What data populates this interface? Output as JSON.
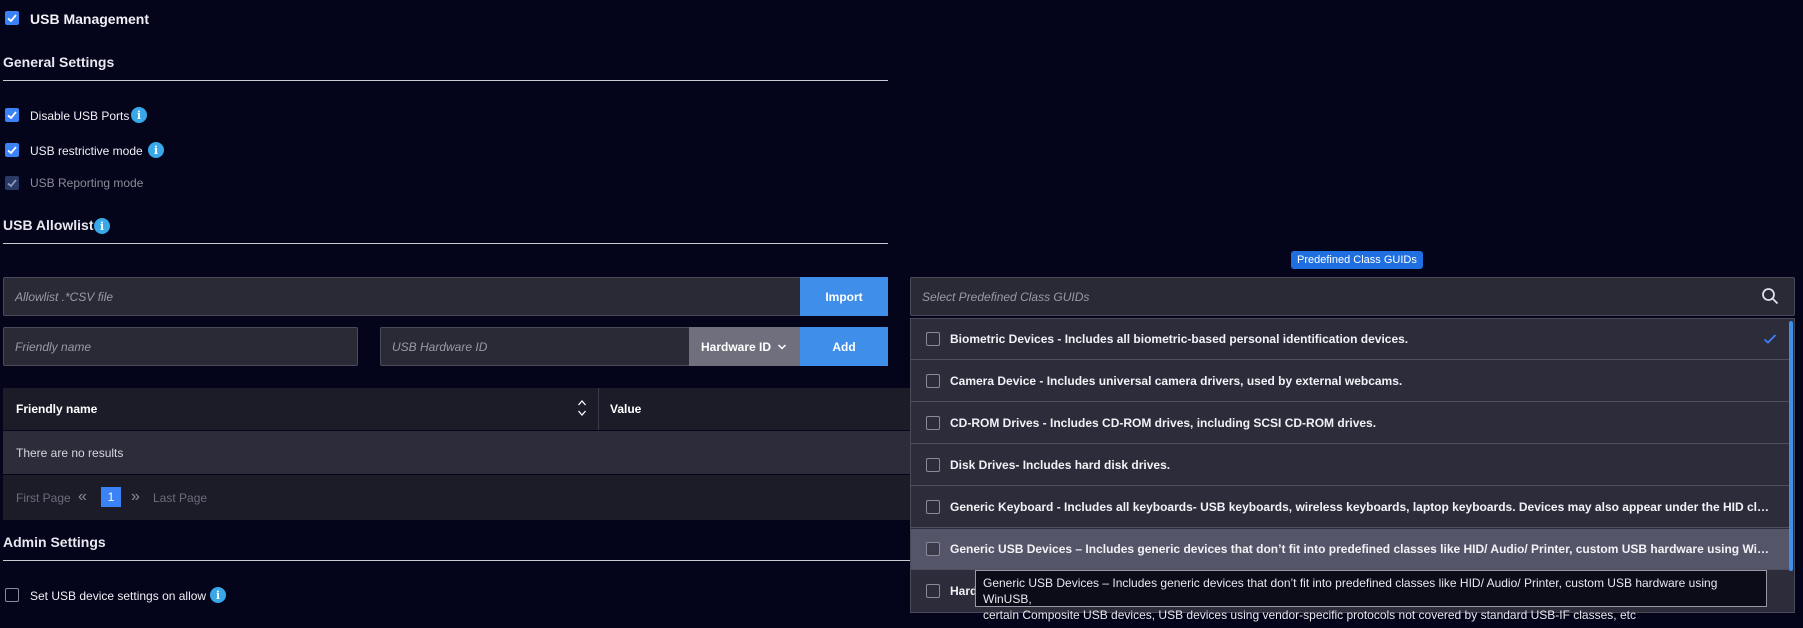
{
  "header": {
    "usb_management": {
      "label": "USB Management",
      "checked": true
    }
  },
  "general": {
    "title": "General Settings",
    "options": [
      {
        "label": "Disable USB Ports",
        "checked": true,
        "info": true
      },
      {
        "label": "USB restrictive mode",
        "checked": true,
        "info": true
      },
      {
        "label": "USB Reporting mode",
        "checked": true,
        "disabled": true,
        "info": false
      }
    ]
  },
  "allowlist": {
    "title": "USB Allowlist",
    "csv_placeholder": "Allowlist .*CSV file",
    "import_label": "Import",
    "friendly_placeholder": "Friendly name",
    "hardware_placeholder": "USB Hardware ID",
    "hardware_type": "Hardware ID",
    "add_label": "Add",
    "table": {
      "col_friendly": "Friendly name",
      "col_value": "Value",
      "empty": "There are no results"
    },
    "pager": {
      "first": "First Page",
      "current": "1",
      "last": "Last Page"
    }
  },
  "admin": {
    "title": "Admin Settings",
    "set_device": {
      "label": "Set USB device settings on allow",
      "checked": false
    }
  },
  "guid": {
    "tooltip_label": "Predefined Class GUIDs",
    "search_placeholder": "Select Predefined Class GUIDs",
    "items": [
      {
        "label": "Biometric Devices - Includes all biometric-based personal identification devices.",
        "selected": true
      },
      {
        "label": "Camera Device - Includes universal camera drivers, used by external webcams.",
        "selected": false
      },
      {
        "label": "CD-ROM Drives - Includes CD-ROM drives, including SCSI CD-ROM drives.",
        "selected": false
      },
      {
        "label": "Disk Drives- Includes hard disk drives.",
        "selected": false
      },
      {
        "label": "Generic Keyboard - Includes all keyboards- USB keyboards, wireless keyboards, laptop keyboards. Devices may also appear under the HID class if they...",
        "selected": false
      },
      {
        "label": "Generic USB Devices – Includes generic devices that don’t fit into predefined classes like HID/ Audio/ Printer, custom USB hardware using WinUSB, cer...",
        "selected": false,
        "hover": true
      },
      {
        "label": "Hard",
        "selected": false
      }
    ],
    "hover_tooltip_line1": "Generic USB Devices – Includes generic devices that don’t fit into predefined classes like HID/ Audio/ Printer, custom USB hardware using WinUSB,",
    "hover_tooltip_line2": "certain Composite USB devices, USB devices using vendor-specific protocols not covered by standard USB-IF classes, etc"
  },
  "colors": {
    "accent": "#3f8fea",
    "background": "#04041a",
    "info": "#38a8e8"
  }
}
